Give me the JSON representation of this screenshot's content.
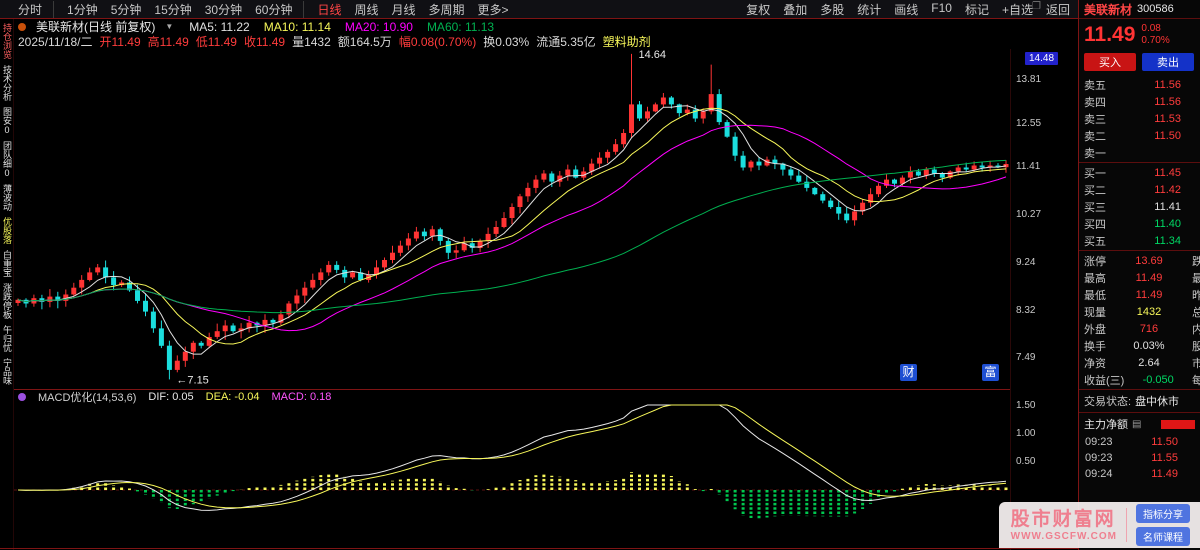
{
  "topbar": {
    "left_items": [
      {
        "label": "分时",
        "sep": true
      },
      {
        "label": "1分钟"
      },
      {
        "label": "5分钟"
      },
      {
        "label": "15分钟"
      },
      {
        "label": "30分钟"
      },
      {
        "label": "60分钟",
        "sep": true
      },
      {
        "label": "日线",
        "active": true
      },
      {
        "label": "周线"
      },
      {
        "label": "月线"
      },
      {
        "label": "多周期"
      },
      {
        "label": "更多>"
      }
    ],
    "right_items": [
      "复权",
      "叠加",
      "多股",
      "统计",
      "画线",
      "F10",
      "标记",
      "+自选",
      "返回"
    ]
  },
  "left_strip": {
    "items": [
      {
        "text": "持仓浏览",
        "color": "#ff6060"
      },
      {
        "text": "技术分析",
        "color": "#e0e0e0"
      },
      {
        "text": "图安0",
        "color": "#e0e0e0"
      },
      {
        "text": "团队细0",
        "color": "#e0e0e0"
      },
      {
        "text": "薄波动",
        "color": "#e0e0e0"
      },
      {
        "text": "优股落",
        "color": "#f7f75a"
      },
      {
        "text": "白重宝",
        "color": "#e0e0e0"
      },
      {
        "text": "涨跌停板",
        "color": "#e0e0e0"
      },
      {
        "text": "午归忧",
        "color": "#e0e0e0"
      },
      {
        "text": "宁品味",
        "color": "#e0e0e0"
      }
    ]
  },
  "icons": {
    "caret_down": "▼",
    "pane": "❐",
    "list": "▤"
  },
  "chart_header": {
    "title": "美联新材(日线 前复权)",
    "ma": [
      {
        "label": "MA5: 11.22",
        "color": "#e0e0e0"
      },
      {
        "label": "MA10: 11.14",
        "color": "#f7f75a"
      },
      {
        "label": "MA20: 10.90",
        "color": "#ff00ff"
      },
      {
        "label": "MA60: 11.13",
        "color": "#00b050"
      }
    ]
  },
  "info_bar": {
    "tokens": [
      {
        "text": "2025/11/18/二",
        "color": "#d8d8d8"
      },
      {
        "text": "开11.49",
        "color": "#ff3c3c"
      },
      {
        "text": "高11.49",
        "color": "#ff3c3c"
      },
      {
        "text": "低11.49",
        "color": "#ff3c3c"
      },
      {
        "text": "收11.49",
        "color": "#ff3c3c"
      },
      {
        "text": "量1432",
        "color": "#d8d8d8"
      },
      {
        "text": "额164.5万",
        "color": "#d8d8d8"
      },
      {
        "text": "幅0.08(0.70%)",
        "color": "#ff3c3c"
      },
      {
        "text": "换0.03%",
        "color": "#d8d8d8"
      },
      {
        "text": "流通5.35亿",
        "color": "#d8d8d8"
      },
      {
        "text": "塑料助剂",
        "color": "#f7f75a"
      }
    ]
  },
  "chart_data": {
    "type": "candlestick",
    "symbol": "美联新材",
    "period": "日线 前复权",
    "y_axis": {
      "scale": "log",
      "max": 14.8,
      "min": 7.0,
      "top_label": "14.48",
      "labels": [
        "13.81",
        "12.55",
        "11.41",
        "10.27",
        "9.24",
        "8.32",
        "7.49"
      ]
    },
    "closes": [
      8.52,
      8.45,
      8.55,
      8.48,
      8.58,
      8.5,
      8.62,
      8.75,
      8.9,
      9.05,
      9.15,
      8.95,
      8.8,
      8.85,
      8.7,
      8.5,
      8.3,
      8.0,
      7.7,
      7.3,
      7.45,
      7.6,
      7.75,
      7.7,
      7.85,
      7.95,
      8.05,
      7.95,
      8.0,
      8.1,
      8.05,
      8.15,
      8.1,
      8.25,
      8.45,
      8.6,
      8.75,
      8.9,
      9.05,
      9.2,
      9.1,
      8.95,
      9.05,
      8.9,
      9.0,
      9.15,
      9.3,
      9.45,
      9.6,
      9.75,
      9.9,
      9.8,
      9.95,
      9.7,
      9.45,
      9.5,
      9.65,
      9.55,
      9.7,
      9.85,
      10.0,
      10.2,
      10.45,
      10.7,
      10.9,
      11.1,
      11.25,
      11.05,
      11.2,
      11.35,
      11.15,
      11.3,
      11.5,
      11.65,
      11.8,
      12.0,
      12.3,
      13.1,
      12.7,
      12.9,
      13.1,
      13.3,
      13.1,
      12.85,
      12.95,
      12.7,
      12.9,
      13.4,
      12.6,
      12.2,
      11.7,
      11.4,
      11.55,
      11.45,
      11.6,
      11.5,
      11.35,
      11.2,
      11.05,
      10.9,
      10.75,
      10.6,
      10.45,
      10.3,
      10.15,
      10.35,
      10.55,
      10.75,
      10.95,
      11.1,
      11.0,
      11.15,
      11.3,
      11.2,
      11.35,
      11.25,
      11.15,
      11.3,
      11.4,
      11.35,
      11.45,
      11.4,
      11.45,
      11.41,
      11.49
    ],
    "wick_overrides": {
      "19": {
        "low": 7.15
      },
      "77": {
        "high": 14.64
      },
      "87": {
        "high": 14.3
      }
    },
    "annotations": [
      {
        "index": 77,
        "text": "14.64",
        "pos": "high"
      },
      {
        "index": 19,
        "text": "←7.15",
        "pos": "low"
      }
    ],
    "ma_periods": [
      5,
      10,
      20,
      60
    ],
    "ma_colors": [
      "#e0e0e0",
      "#f7f75a",
      "#ff00ff",
      "#00b050"
    ],
    "up_color": "#ff3434",
    "down_color": "#1bdede",
    "watermarks": [
      {
        "char": "财"
      },
      {
        "char": "富"
      }
    ]
  },
  "macd": {
    "header": {
      "name": "MACD优化(14,53,6)",
      "dif_label": "DIF: 0.05",
      "dea_label": "DEA: -0.04",
      "macd_label": "MACD: 0.18"
    },
    "params": {
      "fast": 14,
      "slow": 53,
      "signal": 6
    },
    "axis_labels": [
      "1.50",
      "1.00",
      "0.50"
    ],
    "dif_color": "#e8e8e8",
    "dea_color": "#f7f75a",
    "pos_color": "#f7f75a",
    "neg_color": "#00c850"
  },
  "sidebar": {
    "stock_name": "美联新材",
    "stock_code": "300586",
    "price": "11.49",
    "change": "0.08",
    "change_pct": "0.70%",
    "buy_button": "买入",
    "sell_button": "卖出",
    "asks": [
      {
        "label": "卖五",
        "price": "11.56",
        "color": "red"
      },
      {
        "label": "卖四",
        "price": "11.56",
        "color": "red"
      },
      {
        "label": "卖三",
        "price": "11.53",
        "color": "red"
      },
      {
        "label": "卖二",
        "price": "11.50",
        "color": "red"
      },
      {
        "label": "卖一",
        "price": "",
        "color": "white"
      }
    ],
    "bids": [
      {
        "label": "买一",
        "price": "11.45",
        "color": "red"
      },
      {
        "label": "买二",
        "price": "11.42",
        "color": "red"
      },
      {
        "label": "买三",
        "price": "11.41",
        "color": "white"
      },
      {
        "label": "买四",
        "price": "11.40",
        "color": "green"
      },
      {
        "label": "买五",
        "price": "11.34",
        "color": "green"
      }
    ],
    "stats": [
      {
        "label": "涨停",
        "value": "13.69",
        "color": "red",
        "extra": "跌"
      },
      {
        "label": "最高",
        "value": "11.49",
        "color": "red",
        "extra": "最"
      },
      {
        "label": "最低",
        "value": "11.49",
        "color": "red",
        "extra": "昨"
      },
      {
        "label": "现量",
        "value": "1432",
        "color": "yellow",
        "extra": "总"
      },
      {
        "label": "外盘",
        "value": "716",
        "color": "red",
        "extra": "内"
      },
      {
        "label": "换手",
        "value": "0.03%",
        "color": "white",
        "extra": "股"
      },
      {
        "label": "净资",
        "value": "2.64",
        "color": "white",
        "extra": "市"
      },
      {
        "label": "收益(三)",
        "value": "-0.050",
        "color": "green",
        "extra": "每"
      }
    ],
    "trade_status": {
      "label": "交易状态:",
      "value": "盘中休市"
    },
    "main_flow": {
      "label": "主力净额"
    },
    "ticks": [
      {
        "time": "09:23",
        "price": "11.50",
        "color": "red"
      },
      {
        "time": "09:23",
        "price": "11.55",
        "color": "red"
      },
      {
        "time": "09:24",
        "price": "11.49",
        "color": "red"
      }
    ]
  },
  "watermark": {
    "site_name": "股市财富网",
    "site_url": "WWW.GSCFW.COM",
    "badges": [
      "指标分享",
      "名师课程"
    ]
  },
  "colors": {
    "red": "#ff3c3c",
    "green": "#00d864",
    "yellow": "#f7f75a",
    "white": "#e0e0e0",
    "border": "#7e1414",
    "axis_box_bg": "#2222cc"
  }
}
